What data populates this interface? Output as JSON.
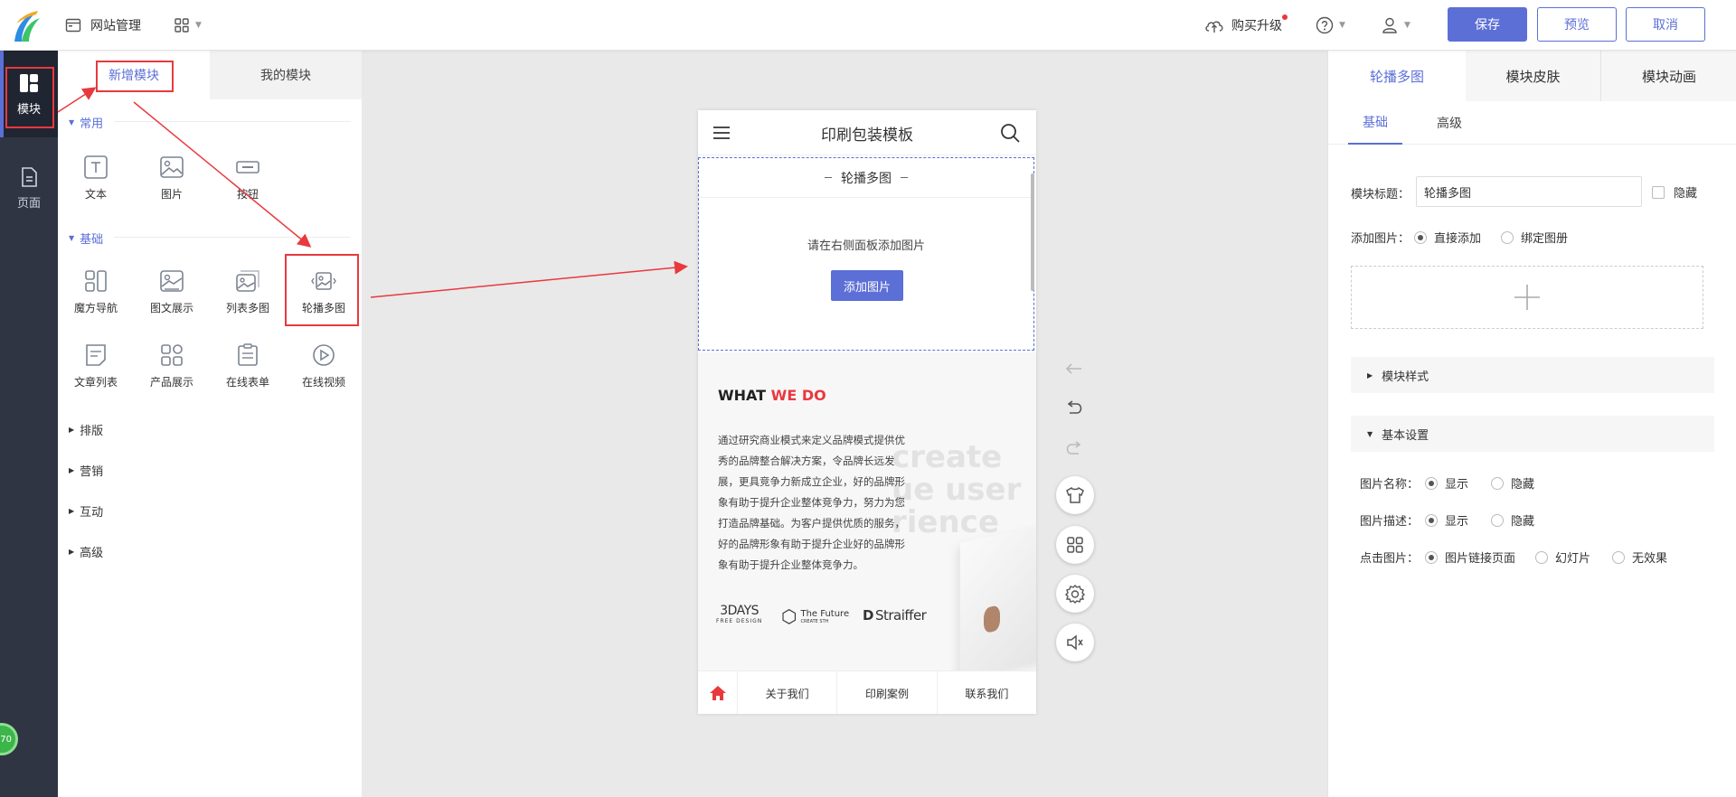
{
  "topbar": {
    "site_manage": "网站管理",
    "buy_upgrade": "购买升级",
    "save": "保存",
    "preview": "预览",
    "cancel": "取消"
  },
  "leftnav": {
    "items": [
      {
        "label": "模块",
        "icon": "module-icon",
        "active": true
      },
      {
        "label": "页面",
        "icon": "page-icon",
        "active": false
      }
    ],
    "badge": "70"
  },
  "module_panel": {
    "tabs": [
      "新增模块",
      "我的模块"
    ],
    "sections": [
      {
        "title": "常用",
        "expanded": true,
        "items": [
          "文本",
          "图片",
          "按钮"
        ]
      },
      {
        "title": "基础",
        "expanded": true,
        "items": [
          "魔方导航",
          "图文展示",
          "列表多图",
          "轮播多图",
          "文章列表",
          "产品展示",
          "在线表单",
          "在线视频"
        ]
      },
      {
        "title": "排版",
        "expanded": false
      },
      {
        "title": "营销",
        "expanded": false
      },
      {
        "title": "互动",
        "expanded": false
      },
      {
        "title": "高级",
        "expanded": false
      }
    ]
  },
  "phone": {
    "title": "印刷包装模板",
    "carousel_title": "轮播多图",
    "carousel_hint": "请在右侧面板添加图片",
    "add_image": "添加图片",
    "what": "WHAT ",
    "we_do": "WE DO",
    "body_lines": [
      "通过研究商业模式来定义品牌模式提供优",
      "秀的品牌整合解决方案，令品牌长远发",
      "展，更具竞争力新成立企业，好的品牌形",
      "象有助于提升企业整体竞争力，努力为您",
      "打造品牌基础。为客户提供优质的服务，",
      "好的品牌形象有助于提升企业好的品牌形",
      "象有助于提升企业整体竞争力。"
    ],
    "bg_words": [
      "create",
      "ue user",
      "rience"
    ],
    "logos": {
      "days_main": "3DAYS",
      "days_sub": "FREE DESIGN",
      "future_main": "The Future",
      "future_sub": "CREATE STH",
      "straiffer": "Straiffer"
    },
    "footer": [
      "关于我们",
      "印刷案例",
      "联系我们"
    ]
  },
  "right_panel": {
    "tabs": [
      "轮播多图",
      "模块皮肤",
      "模块动画"
    ],
    "subtabs": [
      "基础",
      "高级"
    ],
    "title_label": "模块标题：",
    "title_value": "轮播多图",
    "hide": "隐藏",
    "add_image_label": "添加图片：",
    "add_options": [
      "直接添加",
      "绑定图册"
    ],
    "module_style": "模块样式",
    "basic_settings": "基本设置",
    "image_name_label": "图片名称：",
    "image_desc_label": "图片描述：",
    "click_label": "点击图片：",
    "show": "显示",
    "hide2": "隐藏",
    "click_options": [
      "图片链接页面",
      "幻灯片",
      "无效果"
    ]
  },
  "colors": {
    "accent": "#5b6fd6",
    "highlight": "#e8393f",
    "nav_bg": "#2f3543"
  }
}
